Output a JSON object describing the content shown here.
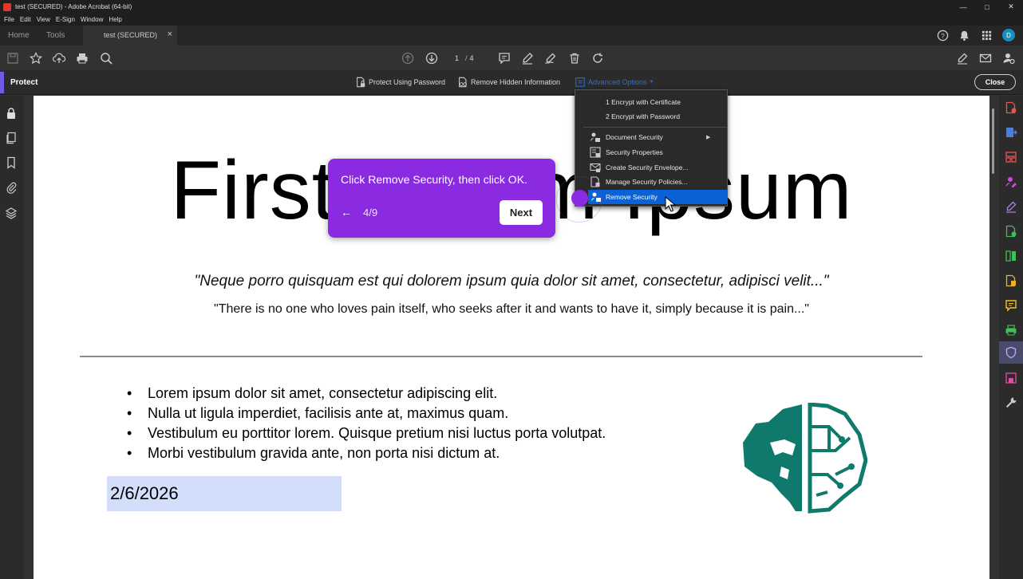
{
  "window": {
    "title": "test (SECURED) - Adobe Acrobat (64-bit)"
  },
  "menubar": [
    "File",
    "Edit",
    "View",
    "E-Sign",
    "Window",
    "Help"
  ],
  "tabs": {
    "home": "Home",
    "tools": "Tools",
    "document": "test (SECURED)"
  },
  "account": {
    "initial": "D"
  },
  "toolbar": {
    "page_current": "1",
    "page_sep": "/",
    "page_total": "4"
  },
  "protect_bar": {
    "title": "Protect",
    "protect_password": "Protect Using Password",
    "remove_hidden": "Remove Hidden Information",
    "advanced_options": "Advanced Options",
    "close": "Close"
  },
  "advanced_menu": {
    "encrypt_certificate": "1 Encrypt with Certificate",
    "encrypt_password": "2 Encrypt with Password",
    "document_security": "Document Security",
    "security_properties": "Security Properties",
    "create_envelope": "Create Security Envelope...",
    "manage_policies": "Manage Security Policies...",
    "remove_security": "Remove Security"
  },
  "document": {
    "heading": "First Lorem Ipsum",
    "quote_italic": "\"Neque porro quisquam est qui dolorem ipsum quia dolor sit amet, consectetur, adipisci velit...\"",
    "quote_plain": "\"There is no one who loves pain itself, who seeks after it and wants to have it, simply because it is pain...\"",
    "bullets": [
      "Lorem ipsum dolor sit amet, consectetur adipiscing elit.",
      "Nulla ut ligula imperdiet, facilisis ante at, maximus quam.",
      "Vestibulum eu porttitor lorem. Quisque pretium nisi luctus porta volutpat.",
      "Morbi vestibulum gravida ante, non porta nisi dictum at."
    ],
    "date_field": "2/6/2026"
  },
  "tour": {
    "message": "Click Remove Security, then click OK.",
    "step": "4/9",
    "next": "Next"
  },
  "colors": {
    "accent": "#8a2be2",
    "selected": "#0b62d6",
    "logo": "#0f7a6c"
  }
}
